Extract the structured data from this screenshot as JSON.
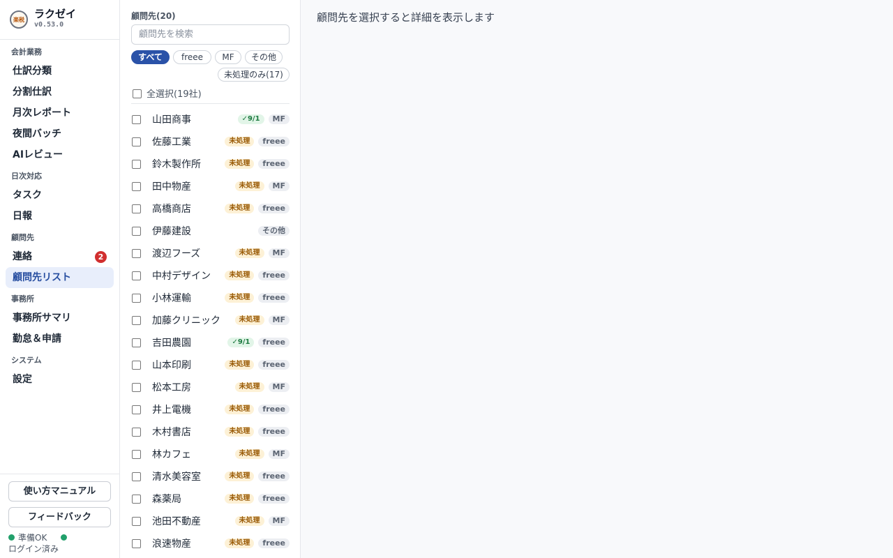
{
  "app": {
    "name": "ラクゼイ",
    "version": "v0.53.0",
    "logo_text": "楽税"
  },
  "sidebar": {
    "sections": [
      {
        "label": "会計業務",
        "items": [
          "仕訳分類",
          "分割仕訳",
          "月次レポート",
          "夜間バッチ",
          "AIレビュー"
        ]
      },
      {
        "label": "日次対応",
        "items": [
          "タスク",
          "日報"
        ]
      },
      {
        "label": "顧問先",
        "items": [
          "連絡",
          "顧問先リスト"
        ]
      },
      {
        "label": "事務所",
        "items": [
          "事務所サマリ",
          "勤怠＆申請"
        ]
      },
      {
        "label": "システム",
        "items": [
          "設定"
        ]
      }
    ],
    "contact_badge": "2",
    "active_item": "顧問先リスト",
    "footer": {
      "manual_button": "使い方マニュアル",
      "feedback_button": "フィードバック",
      "status_ready": "準備OK",
      "status_login": "ログイン済み"
    }
  },
  "clients": {
    "title": "顧問先(20)",
    "search_placeholder": "顧問先を検索",
    "filters": [
      "すべて",
      "freee",
      "MF",
      "その他",
      "未処理のみ(17)"
    ],
    "active_filter": "すべて",
    "select_all_label": "全選択(19社)",
    "rows": [
      {
        "name": "山田商事",
        "status": "✓9/1",
        "status_type": "done",
        "system": "MF"
      },
      {
        "name": "佐藤工業",
        "status": "未処理",
        "status_type": "pending",
        "system": "freee"
      },
      {
        "name": "鈴木製作所",
        "status": "未処理",
        "status_type": "pending",
        "system": "freee"
      },
      {
        "name": "田中物産",
        "status": "未処理",
        "status_type": "pending",
        "system": "MF"
      },
      {
        "name": "高橋商店",
        "status": "未処理",
        "status_type": "pending",
        "system": "freee"
      },
      {
        "name": "伊藤建設",
        "status": "",
        "status_type": "none",
        "system": "その他"
      },
      {
        "name": "渡辺フーズ",
        "status": "未処理",
        "status_type": "pending",
        "system": "MF"
      },
      {
        "name": "中村デザイン",
        "status": "未処理",
        "status_type": "pending",
        "system": "freee"
      },
      {
        "name": "小林運輸",
        "status": "未処理",
        "status_type": "pending",
        "system": "freee"
      },
      {
        "name": "加藤クリニック",
        "status": "未処理",
        "status_type": "pending",
        "system": "MF"
      },
      {
        "name": "吉田農園",
        "status": "✓9/1",
        "status_type": "done",
        "system": "freee"
      },
      {
        "name": "山本印刷",
        "status": "未処理",
        "status_type": "pending",
        "system": "freee"
      },
      {
        "name": "松本工房",
        "status": "未処理",
        "status_type": "pending",
        "system": "MF"
      },
      {
        "name": "井上電機",
        "status": "未処理",
        "status_type": "pending",
        "system": "freee"
      },
      {
        "name": "木村書店",
        "status": "未処理",
        "status_type": "pending",
        "system": "freee"
      },
      {
        "name": "林カフェ",
        "status": "未処理",
        "status_type": "pending",
        "system": "MF"
      },
      {
        "name": "清水美容室",
        "status": "未処理",
        "status_type": "pending",
        "system": "freee"
      },
      {
        "name": "森薬局",
        "status": "未処理",
        "status_type": "pending",
        "system": "freee"
      },
      {
        "name": "池田不動産",
        "status": "未処理",
        "status_type": "pending",
        "system": "MF"
      },
      {
        "name": "浪速物産",
        "status": "未処理",
        "status_type": "pending",
        "system": "freee"
      }
    ]
  },
  "detail": {
    "placeholder": "顧問先を選択すると詳細を表示します"
  },
  "colors": {
    "accent": "#2a52a8",
    "active_nav_bg": "#e8eefb",
    "badge": "#d12f2f",
    "pending_bg": "#fdf1d6",
    "done_bg": "#e2f5e8",
    "status_dot": "#22a06b"
  }
}
